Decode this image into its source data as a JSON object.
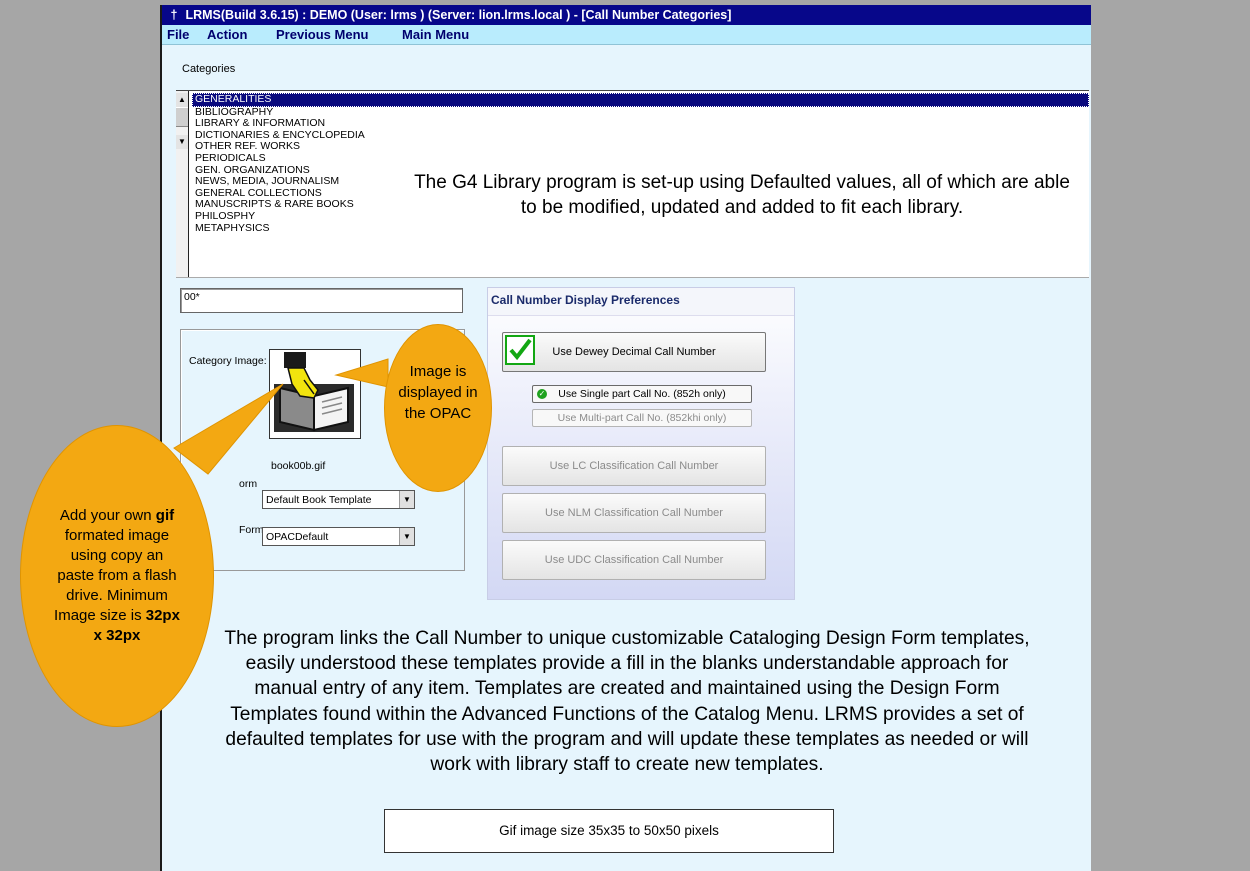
{
  "title": "LRMS(Build 3.6.15) : DEMO (User: lrms ) (Server: lion.lrms.local ) - [Call Number Categories]",
  "menu": [
    "File",
    "Action",
    "Previous Menu",
    "Main Menu"
  ],
  "categories_label": "Categories",
  "categories": [
    "GENERALITIES",
    "BIBLIOGRAPHY",
    "LIBRARY & INFORMATION",
    "DICTIONARIES & ENCYCLOPEDIA",
    "OTHER REF. WORKS",
    "PERIODICALS",
    "GEN. ORGANIZATIONS",
    "NEWS, MEDIA, JOURNALISM",
    "GENERAL COLLECTIONS",
    "MANUSCRIPTS & RARE BOOKS",
    "PHILOSPHY",
    "METAPHYSICS"
  ],
  "selected_category": "GENERALITIES",
  "note_defaults": "The G4 Library program is set-up using Defaulted values, all of which are able to be modified, updated and added to fit each library.",
  "code_value": "00*",
  "category_image_label": "Category Image:",
  "image_filename": "book00b.gif",
  "form_label_1": "orm",
  "form_label_2": "Form",
  "form_select_1": "Default Book Template",
  "form_select_2": "OPACDefault",
  "prefs_title": "Call Number Display Preferences",
  "prefs_dewey": "Use Dewey Decimal Call Number",
  "prefs_single": "Use Single part Call No. (852h only)",
  "prefs_multi": "Use Multi-part Call No. (852khi only)",
  "prefs_lc": "Use LC Classification Call Number",
  "prefs_nlm": "Use NLM Classification Call Number",
  "prefs_udc": "Use UDC Classification Call Number",
  "bubble_opac": "Image is displayed in the OPAC",
  "bubble_gif_pre": "Add your own",
  "bubble_gif_bold": "gif",
  "bubble_gif_post": "formated image using copy an paste from a flash drive. Minimum Image size is",
  "bubble_gif_size": "32px x 32px",
  "note_templates": "The program links the Call Number to unique customizable Cataloging Design Form templates, easily understood these templates provide a fill in the blanks understandable approach for manual entry of any item. Templates are created and maintained using the Design Form Templates found within the Advanced Functions of the Catalog Menu. LRMS provides a set of defaulted templates for use with the program and will update these templates as needed or will work with library staff to create new templates.",
  "gif_size_note": "Gif image size 35x35 to 50x50 pixels",
  "icons": {
    "title": "app-icon",
    "image": "book-hand-icon",
    "check": "checkmark-icon",
    "radio": "radio-selected-icon"
  },
  "colors": {
    "titlebar": "#07078a",
    "menubar": "#b9ecfd",
    "window": "#e6f5fd",
    "bubble": "#f3a812",
    "selected": "#0a0a7e"
  }
}
